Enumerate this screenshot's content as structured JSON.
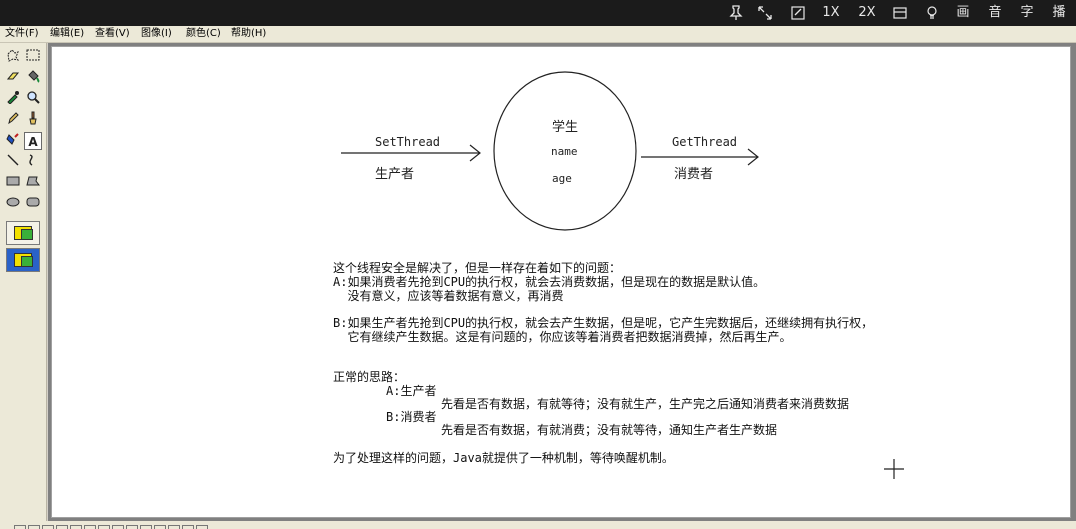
{
  "topbar": {
    "items": [
      "1X",
      "2X",
      "画",
      "音",
      "字",
      "播"
    ]
  },
  "menu": {
    "items": [
      "文件(F)",
      "编辑(E)",
      "查看(V)",
      "图像(I)",
      "颜色(C)",
      "帮助(H)"
    ]
  },
  "diagram": {
    "left_arrow_top": "SetThread",
    "left_arrow_bottom": "生产者",
    "circle_line1": "学生",
    "circle_line2": "name",
    "circle_line3": "age",
    "right_arrow_top": "GetThread",
    "right_arrow_bottom": "消费者"
  },
  "text": {
    "l1": "这个线程安全是解决了，但是一样存在着如下的问题：",
    "l2": "A:如果消费者先抢到CPU的执行权，就会去消费数据，但是现在的数据是默认值。",
    "l3": "  没有意义，应该等着数据有意义，再消费",
    "l4": "B:如果生产者先抢到CPU的执行权，就会去产生数据，但是呢，它产生完数据后，还继续拥有执行权，",
    "l5": "  它有继续产生数据。这是有问题的，你应该等着消费者把数据消费掉，然后再生产。",
    "l6": "正常的思路：",
    "l7": "A:生产者",
    "l8": "先看是否有数据，有就等待；没有就生产，生产完之后通知消费者来消费数据",
    "l9": "B:消费者",
    "l10": "先看是否有数据，有就消费；没有就等待，通知生产者生产数据",
    "l11": "为了处理这样的问题，Java就提供了一种机制，等待唤醒机制。"
  },
  "colors": {
    "topbar": "#1b1b1b",
    "chrome": "#ece9d8",
    "canvas": "#ffffff",
    "selection": "#2a62c8"
  },
  "icons": {
    "topbar": [
      "pin-icon",
      "fullscreen-icon",
      "edit-icon",
      "window-icon",
      "bulb-icon"
    ],
    "tools": [
      "free-select-icon",
      "rect-select-icon",
      "eraser-icon",
      "fill-icon",
      "color-picker-icon",
      "magnifier-icon",
      "pencil-icon",
      "brush-icon",
      "airbrush-icon",
      "text-icon",
      "line-icon",
      "curve-icon",
      "rectangle-icon",
      "polygon-icon",
      "ellipse-icon",
      "rounded-rect-icon"
    ]
  }
}
